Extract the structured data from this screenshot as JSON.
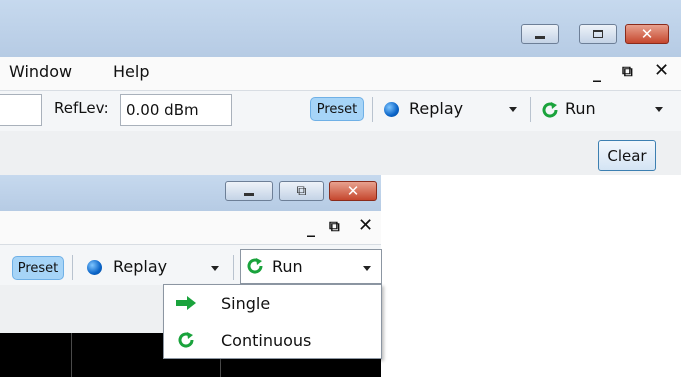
{
  "top": {
    "menu": [
      "Window",
      "Help"
    ],
    "reflev_label": "RefLev:",
    "reflev_value": "0.00 dBm",
    "preset_label": "Preset",
    "replay_label": "Replay",
    "run_label": "Run",
    "clear_label": "Clear"
  },
  "bottom": {
    "preset_label": "Preset",
    "replay_label": "Replay",
    "run_label": "Run",
    "dropdown_items": [
      {
        "label": "Single",
        "icon": "green-arrow-icon"
      },
      {
        "label": "Continuous",
        "icon": "green-refresh-icon"
      }
    ]
  },
  "colors": {
    "accent_green": "#1aa33c",
    "preset_blue": "#a6d4f7",
    "replay_dot": "#0a64c8"
  }
}
